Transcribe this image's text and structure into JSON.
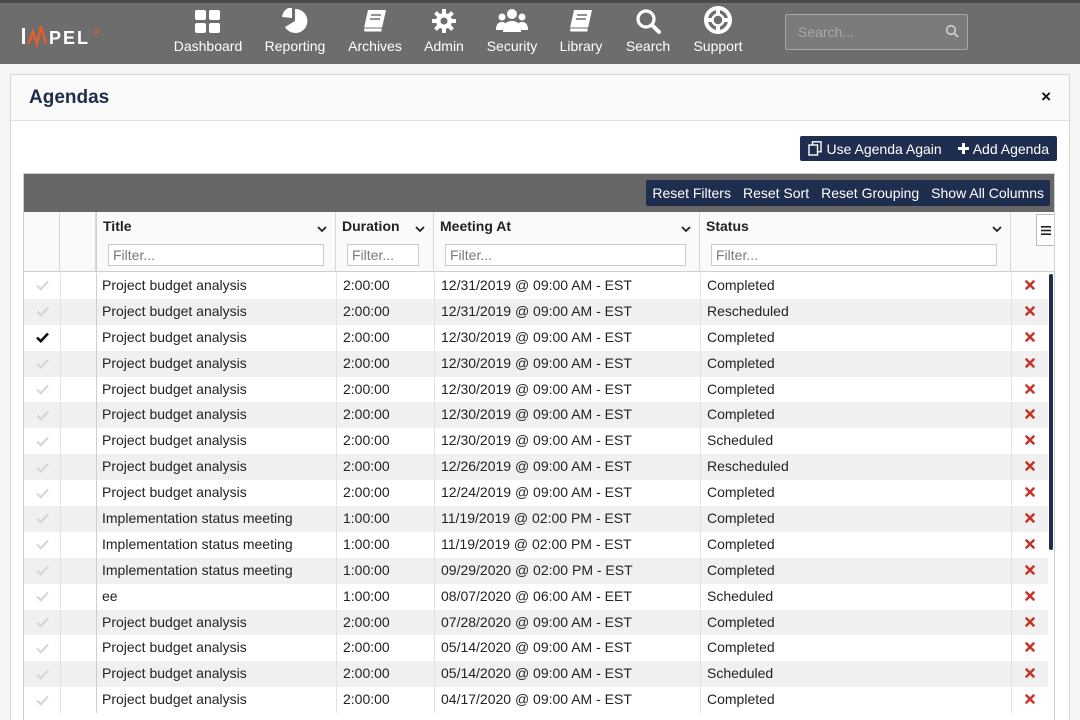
{
  "brand": {
    "logo_text": "IMPEL",
    "logo_suffix": "X"
  },
  "nav": [
    {
      "label": "Dashboard",
      "icon": "dashboard-icon"
    },
    {
      "label": "Reporting",
      "icon": "pie-chart-icon"
    },
    {
      "label": "Archives",
      "icon": "book-icon"
    },
    {
      "label": "Admin",
      "icon": "gear-icon"
    },
    {
      "label": "Security",
      "icon": "users-icon"
    },
    {
      "label": "Library",
      "icon": "book-icon"
    },
    {
      "label": "Search",
      "icon": "search-icon"
    },
    {
      "label": "Support",
      "icon": "lifebuoy-icon"
    }
  ],
  "search": {
    "placeholder": "Search..."
  },
  "panel": {
    "title": "Agendas",
    "close": "×"
  },
  "actions": {
    "use_again": "Use Agenda Again",
    "add": "Add Agenda"
  },
  "grid_tools": {
    "reset_filters": "Reset Filters",
    "reset_sort": "Reset Sort",
    "reset_grouping": "Reset Grouping",
    "show_all": "Show All Columns"
  },
  "columns": {
    "title": "Title",
    "duration": "Duration",
    "meeting_at": "Meeting At",
    "status": "Status",
    "filter_placeholder": "Filter..."
  },
  "colors": {
    "navy": "#1f2d4f",
    "delete": "#c0392b",
    "topbar": "#6d6d6d"
  },
  "rows": [
    {
      "checked": false,
      "title": "Project budget analysis",
      "duration": "2:00:00",
      "meeting_at": "12/31/2019 @ 09:00 AM - EST",
      "status": "Completed"
    },
    {
      "checked": false,
      "title": "Project budget analysis",
      "duration": "2:00:00",
      "meeting_at": "12/31/2019 @ 09:00 AM - EST",
      "status": "Rescheduled"
    },
    {
      "checked": true,
      "title": "Project budget analysis",
      "duration": "2:00:00",
      "meeting_at": "12/30/2019 @ 09:00 AM - EST",
      "status": "Completed"
    },
    {
      "checked": false,
      "title": "Project budget analysis",
      "duration": "2:00:00",
      "meeting_at": "12/30/2019 @ 09:00 AM - EST",
      "status": "Completed"
    },
    {
      "checked": false,
      "title": "Project budget analysis",
      "duration": "2:00:00",
      "meeting_at": "12/30/2019 @ 09:00 AM - EST",
      "status": "Completed"
    },
    {
      "checked": false,
      "title": "Project budget analysis",
      "duration": "2:00:00",
      "meeting_at": "12/30/2019 @ 09:00 AM - EST",
      "status": "Completed"
    },
    {
      "checked": false,
      "title": "Project budget analysis",
      "duration": "2:00:00",
      "meeting_at": "12/30/2019 @ 09:00 AM - EST",
      "status": "Scheduled"
    },
    {
      "checked": false,
      "title": "Project budget analysis",
      "duration": "2:00:00",
      "meeting_at": "12/26/2019 @ 09:00 AM - EST",
      "status": "Rescheduled"
    },
    {
      "checked": false,
      "title": "Project budget analysis",
      "duration": "2:00:00",
      "meeting_at": "12/24/2019 @ 09:00 AM - EST",
      "status": "Completed"
    },
    {
      "checked": false,
      "title": "Implementation status meeting",
      "duration": "1:00:00",
      "meeting_at": "11/19/2019 @ 02:00 PM - EST",
      "status": "Completed"
    },
    {
      "checked": false,
      "title": "Implementation status meeting",
      "duration": "1:00:00",
      "meeting_at": "11/19/2019 @ 02:00 PM - EST",
      "status": "Completed"
    },
    {
      "checked": false,
      "title": "Implementation status meeting",
      "duration": "1:00:00",
      "meeting_at": "09/29/2020 @ 02:00 PM - EST",
      "status": "Completed"
    },
    {
      "checked": false,
      "title": "ee",
      "duration": "1:00:00",
      "meeting_at": "08/07/2020 @ 06:00 AM - EET",
      "status": "Scheduled"
    },
    {
      "checked": false,
      "title": "Project budget analysis",
      "duration": "2:00:00",
      "meeting_at": "07/28/2020 @ 09:00 AM - EST",
      "status": "Completed"
    },
    {
      "checked": false,
      "title": "Project budget analysis",
      "duration": "2:00:00",
      "meeting_at": "05/14/2020 @ 09:00 AM - EST",
      "status": "Completed"
    },
    {
      "checked": false,
      "title": "Project budget analysis",
      "duration": "2:00:00",
      "meeting_at": "05/14/2020 @ 09:00 AM - EST",
      "status": "Scheduled"
    },
    {
      "checked": false,
      "title": "Project budget analysis",
      "duration": "2:00:00",
      "meeting_at": "04/17/2020 @ 09:00 AM - EST",
      "status": "Completed"
    }
  ]
}
